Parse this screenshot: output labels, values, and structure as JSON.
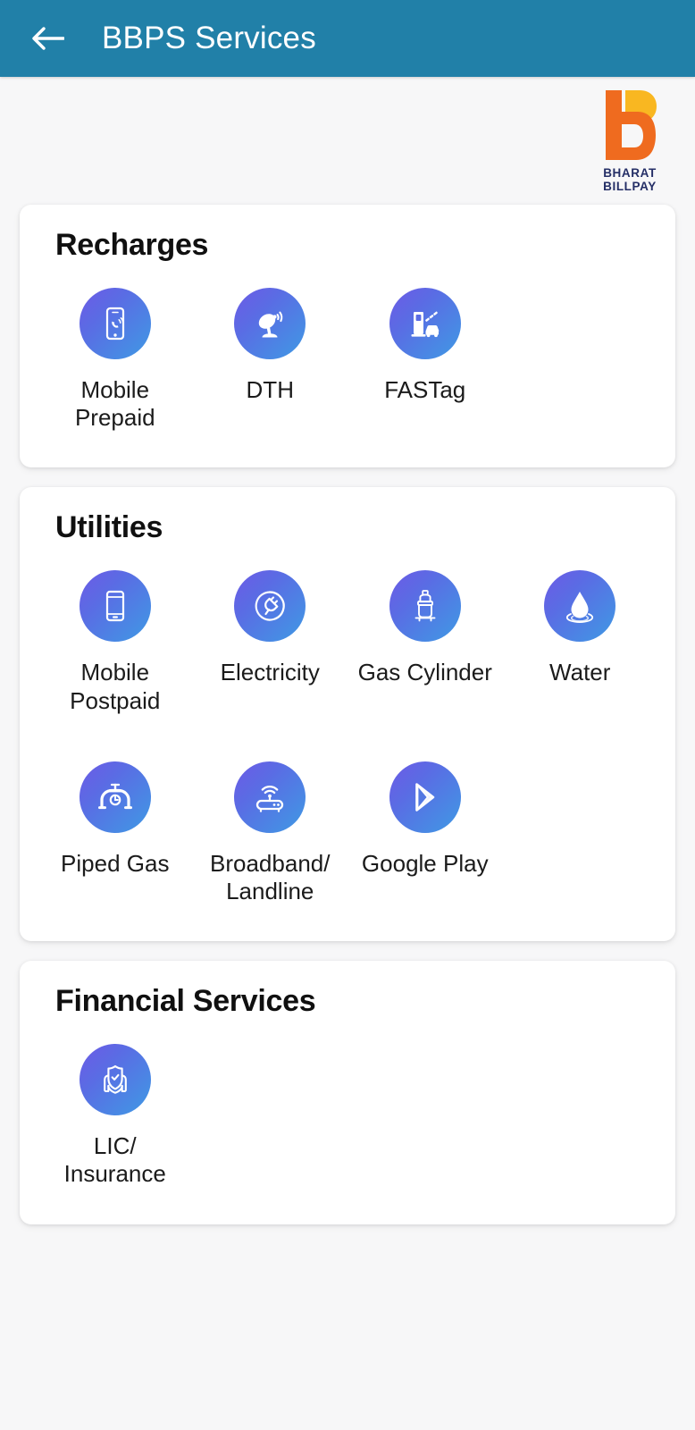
{
  "appbar": {
    "title": "BBPS Services",
    "back_icon": "arrow-left-icon",
    "background_color": "#2180a8",
    "title_color": "#ffffff"
  },
  "logo": {
    "name": "bharat-billpay-logo",
    "line1": "BHARAT",
    "line2": "BILLPAY",
    "mark_primary_color": "#ef6b1f",
    "mark_secondary_color": "#f9b721",
    "text_color": "#242e66"
  },
  "theme": {
    "page_background": "#f7f7f8",
    "card_background": "#ffffff",
    "icon_gradient_start": "#6d5ae6",
    "icon_gradient_end": "#3f9ae4",
    "label_color": "#1b1b1b",
    "heading_color": "#101010"
  },
  "sections": [
    {
      "id": "recharges",
      "title": "Recharges",
      "items": [
        {
          "id": "mobile-prepaid",
          "label": "Mobile\nPrepaid",
          "icon": "mobile-phone-call-icon"
        },
        {
          "id": "dth",
          "label": "DTH",
          "icon": "satellite-dish-icon"
        },
        {
          "id": "fastag",
          "label": "FASTag",
          "icon": "toll-booth-car-icon"
        }
      ]
    },
    {
      "id": "utilities",
      "title": "Utilities",
      "items": [
        {
          "id": "mobile-postpaid",
          "label": "Mobile\nPostpaid",
          "icon": "smartphone-icon"
        },
        {
          "id": "electricity",
          "label": "Electricity",
          "icon": "electric-plug-icon"
        },
        {
          "id": "gas-cylinder",
          "label": "Gas Cylinder",
          "icon": "gas-cylinder-icon"
        },
        {
          "id": "water",
          "label": "Water",
          "icon": "water-drop-icon"
        },
        {
          "id": "piped-gas",
          "label": "Piped Gas",
          "icon": "pipeline-valve-icon"
        },
        {
          "id": "broadband-landline",
          "label": "Broadband/\nLandline",
          "icon": "wifi-router-icon"
        },
        {
          "id": "google-play",
          "label": "Google Play",
          "icon": "google-play-icon"
        }
      ]
    },
    {
      "id": "financial-services",
      "title": "Financial Services",
      "items": [
        {
          "id": "lic-insurance",
          "label": "LIC/\nInsurance",
          "icon": "insurance-shield-hands-icon"
        }
      ]
    }
  ]
}
